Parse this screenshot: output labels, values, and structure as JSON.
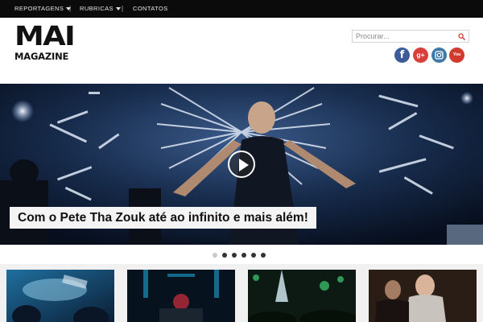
{
  "topnav": {
    "items": [
      {
        "label": "REPORTAGENS",
        "has_dropdown": true
      },
      {
        "label": "RUBRICAS",
        "has_dropdown": true
      },
      {
        "label": "CONTATOS",
        "has_dropdown": false
      }
    ],
    "separator": "|"
  },
  "logo": {
    "line1": "MAI",
    "line2": "MAGAZINE"
  },
  "search": {
    "placeholder": "Procurar..."
  },
  "social": {
    "facebook": {
      "glyph": "f",
      "color": "#3b5b9a"
    },
    "google_plus": {
      "glyph": "g+",
      "color": "#d9403a"
    },
    "instagram": {
      "glyph": "instagram-icon",
      "color": "#3f79a8"
    },
    "youtube": {
      "glyph": "You Tube",
      "color": "#d23a2e"
    }
  },
  "slider": {
    "caption": "Com o Pete Tha Zouk até ao infinito e mais além!",
    "slide_count": 6,
    "active_index": 0
  },
  "thumbnails": {
    "items": [
      {
        "topic": "club-crowd"
      },
      {
        "topic": "dj-stage"
      },
      {
        "topic": "festival-stage"
      },
      {
        "topic": "party-people"
      }
    ]
  },
  "colors": {
    "topbar": "#0b0b0b",
    "caption_bg": "#f4f4f4",
    "band": "#f1f1f1"
  }
}
